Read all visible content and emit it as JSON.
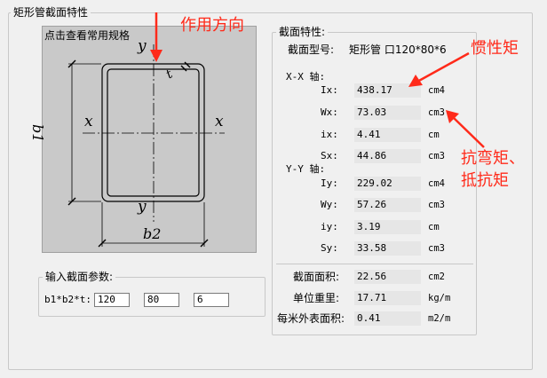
{
  "outer_group": {
    "title": "矩形管截面特性"
  },
  "diagram": {
    "button_label": "点击查看常用规格",
    "y_top": "y",
    "y_bottom": "y",
    "x_left": "x",
    "x_right": "x",
    "b1": "b1",
    "b2": "b2",
    "t": "t"
  },
  "input_group": {
    "title": "输入截面参数:",
    "label": "b1*b2*t:",
    "b1": "120",
    "b2": "80",
    "t": "6"
  },
  "props_group": {
    "title": "截面特性:",
    "section_type_label": "截面型号:",
    "section_type_value": "矩形管 口120*80*6",
    "xx_header": "X-X 轴:",
    "yy_header": "Y-Y 轴:",
    "xx": [
      {
        "name": "Ix:",
        "value": "438.17",
        "unit": "cm4"
      },
      {
        "name": "Wx:",
        "value": "73.03",
        "unit": "cm3"
      },
      {
        "name": "ix:",
        "value": "4.41",
        "unit": "cm"
      },
      {
        "name": "Sx:",
        "value": "44.86",
        "unit": "cm3"
      }
    ],
    "yy": [
      {
        "name": "Iy:",
        "value": "229.02",
        "unit": "cm4"
      },
      {
        "name": "Wy:",
        "value": "57.26",
        "unit": "cm3"
      },
      {
        "name": "iy:",
        "value": "3.19",
        "unit": "cm"
      },
      {
        "name": "Sy:",
        "value": "33.58",
        "unit": "cm3"
      }
    ],
    "area_label": "截面面积:",
    "area_value": "22.56",
    "area_unit": "cm2",
    "weight_label": "单位重里:",
    "weight_value": "17.71",
    "weight_unit": "kg/m",
    "surface_label": "每米外表面积:",
    "surface_value": "0.41",
    "surface_unit": "m2/m"
  },
  "annotations": {
    "direction": "作用方向",
    "inertia": "惯性矩",
    "bending_1": "抗弯矩、",
    "bending_2": "抵抗矩"
  },
  "colors": {
    "annotation": "#ff2a1a"
  }
}
